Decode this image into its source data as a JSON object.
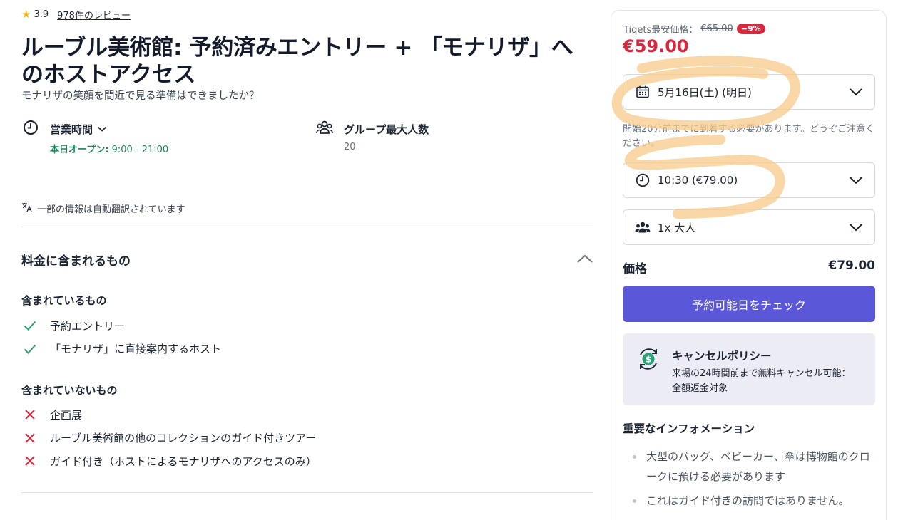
{
  "rating": {
    "value": "3.9",
    "reviews_label": "978件のレビュー"
  },
  "title": "ルーブル美術館: 予約済みエントリー + 「モナリザ」へのホストアクセス",
  "subtitle": "モナリザの笑顔を間近で見る準備はできましたか？",
  "hours": {
    "heading": "営業時間",
    "open_label": "本日オープン:",
    "open_time": " 9:00 - 21:00"
  },
  "group": {
    "heading": "グループ最大人数",
    "value": "20"
  },
  "translate_note": "一部の情報は自動翻訳されています",
  "included_section": {
    "heading": "料金に含まれるもの",
    "included_heading": "含まれているもの",
    "included": [
      "予約エントリー",
      "「モナリザ」に直接案内するホスト"
    ],
    "excluded_heading": "含まれていないもの",
    "excluded": [
      "企画展",
      "ルーブル美術館の他のコレクションのガイド付きツアー",
      "ガイド付き（ホストによるモナリザへのアクセスのみ）"
    ]
  },
  "panel": {
    "price_prefix": "Tiqets最安価格：",
    "old_price": "€65.00",
    "discount": "−9%",
    "price": "€59.00",
    "date_value": "5月16日(土) (明日)",
    "arrival_note": "開始20分前までに到着する必要があります。どうぞご注意ください。",
    "time_value": "10:30 (€79.00)",
    "guests_value": "1x 大人",
    "price_label": "価格",
    "price_total": "€79.00",
    "cta_label": "予約可能日をチェック",
    "cancel_title": "キャンセルポリシー",
    "cancel_text": "来場の24時間前まで無料キャンセル可能：全額返金対象",
    "important_title": "重要なインフォメーション",
    "important_items": [
      "大型のバッグ、ベビーカー、傘は博物館のクロークに預ける必要があります",
      "これはガイド付きの訪問ではありません。"
    ]
  },
  "colors": {
    "accent": "#5b57d9",
    "price_red": "#d9283e",
    "check_green": "#2e9e74",
    "cross_red": "#d9283e",
    "open_green": "#17855c",
    "highlight": "#f8c98a"
  }
}
